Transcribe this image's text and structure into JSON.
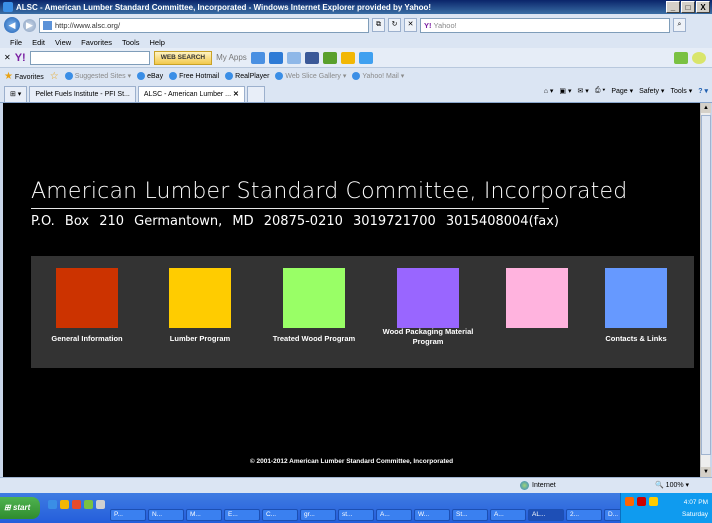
{
  "window": {
    "title": "ALSC - American Lumber Standard Committee, Incorporated - Windows Internet Explorer provided by Yahoo!",
    "min_label": "_",
    "max_label": "□",
    "close_label": "X"
  },
  "address_bar": {
    "url": "http://www.alsc.org/",
    "search_placeholder": "Yahoo!"
  },
  "menu": [
    "File",
    "Edit",
    "View",
    "Favorites",
    "Tools",
    "Help"
  ],
  "yahoo_toolbar": {
    "web_search_label": "WEB SEARCH",
    "my_apps_label": "My Apps"
  },
  "favorites_bar": {
    "favorites_label": "Favorites",
    "items": [
      "Suggested Sites ▾",
      "eBay",
      "Free Hotmail",
      "RealPlayer",
      "Web Slice Gallery ▾",
      "Yahoo! Mail ▾"
    ]
  },
  "tabs": [
    {
      "label": "Pellet Fuels Institute - PFI St...",
      "active": false
    },
    {
      "label": "ALSC - American Lumber ...",
      "active": true
    }
  ],
  "tab_tools": [
    "Page ▾",
    "Safety ▾",
    "Tools ▾"
  ],
  "site": {
    "title": "American Lumber Standard Committee, Incorporated",
    "address": "P.O. Box 210 Germantown, MD 20875-0210 3019721700 3015408004(fax)",
    "copyright": "© 2001-2012 American Lumber Standard Committee, Incorporated",
    "nav": [
      {
        "label": "General Information",
        "color": "#cc3300"
      },
      {
        "label": "Lumber Program",
        "color": "#ffcc00"
      },
      {
        "label": "Treated Wood Program",
        "color": "#99ff66"
      },
      {
        "label": "Wood Packaging Material Program",
        "color": "#9966ff"
      },
      {
        "label": "",
        "color": "#ffb3de"
      },
      {
        "label": "Contacts & Links",
        "color": "#6699ff"
      }
    ]
  },
  "status": {
    "zone": "Internet",
    "zoom": "100%"
  },
  "taskbar": {
    "start_label": "start",
    "tasks": [
      "P...",
      "N...",
      "M...",
      "E...",
      "C...",
      "gr...",
      "st...",
      "A...",
      "W...",
      "St...",
      "A...",
      "AL...",
      "2...",
      "D...",
      "D..."
    ],
    "time": "4:07 PM",
    "day": "Saturday"
  }
}
